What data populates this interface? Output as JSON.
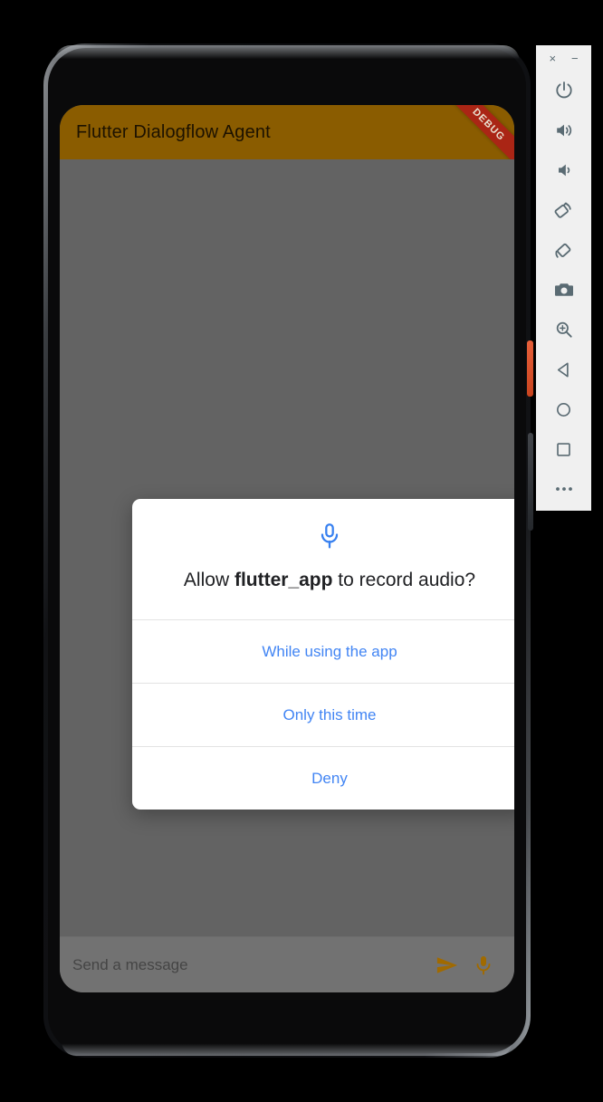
{
  "app": {
    "title": "Flutter Dialogflow Agent",
    "debug_banner": "DEBUG",
    "appbar_color": "#8a5c00",
    "scrim_color": "#636363",
    "accent_color": "#a06a00"
  },
  "message_bar": {
    "placeholder": "Send a message",
    "value": "",
    "send_icon": "send-icon",
    "mic_icon": "microphone-icon"
  },
  "permission_dialog": {
    "icon": "microphone-icon",
    "icon_color": "#3780f0",
    "title_prefix": "Allow ",
    "app_name": "flutter_app",
    "title_suffix": " to record audio?",
    "options": [
      {
        "label": "While using the app",
        "name": "allow-while-using-app"
      },
      {
        "label": "Only this time",
        "name": "allow-only-this-time"
      },
      {
        "label": "Deny",
        "name": "deny"
      }
    ],
    "option_color": "#4285f4"
  },
  "emulator_toolbar": {
    "window_buttons": [
      {
        "label": "×",
        "name": "emulator-close-button"
      },
      {
        "label": "−",
        "name": "emulator-minimize-button"
      }
    ],
    "buttons": [
      {
        "name": "power-icon",
        "title": "Power"
      },
      {
        "name": "volume-up-icon",
        "title": "Volume Up"
      },
      {
        "name": "volume-down-icon",
        "title": "Volume Down"
      },
      {
        "name": "rotate-left-icon",
        "title": "Rotate Left"
      },
      {
        "name": "rotate-right-icon",
        "title": "Rotate Right"
      },
      {
        "name": "screenshot-camera-icon",
        "title": "Take Screenshot"
      },
      {
        "name": "zoom-in-icon",
        "title": "Zoom"
      },
      {
        "name": "back-icon",
        "title": "Back"
      },
      {
        "name": "home-icon",
        "title": "Home"
      },
      {
        "name": "overview-icon",
        "title": "Overview"
      },
      {
        "name": "more-icon",
        "title": "More"
      }
    ]
  }
}
